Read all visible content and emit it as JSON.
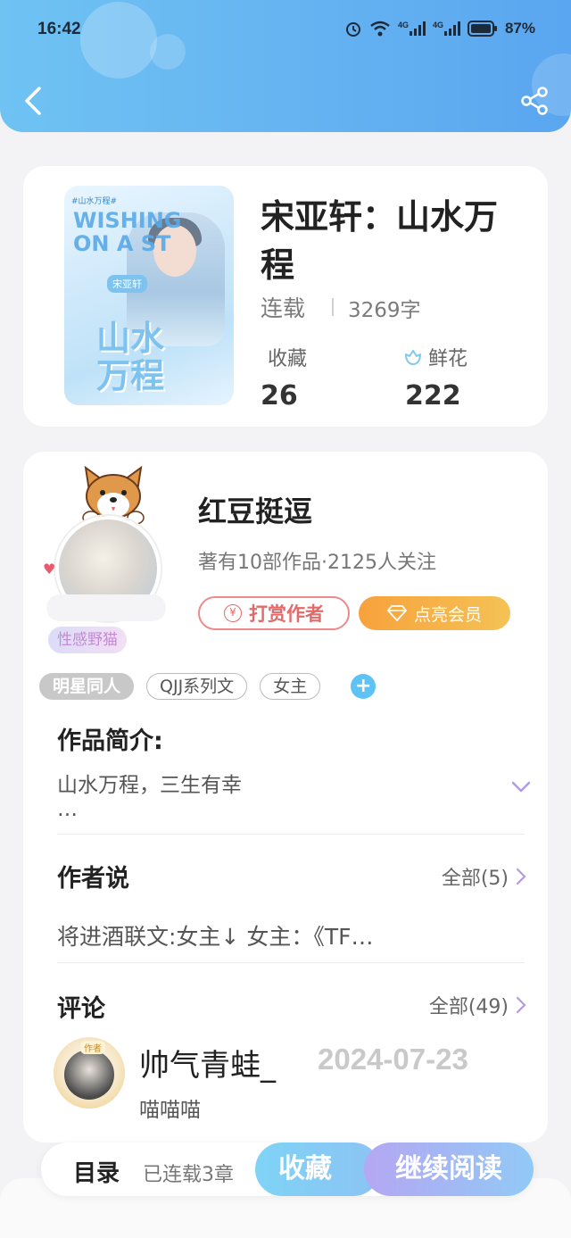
{
  "status_bar": {
    "time": "16:42",
    "network_1": "4G",
    "network_2": "4G",
    "battery": "87%"
  },
  "nav": {
    "back_icon": "chevron-left-icon",
    "share_icon": "share-icon"
  },
  "book": {
    "title": "宋亚轩：山水万程",
    "status": "连载",
    "word_count": "3269字",
    "stats": {
      "collect_label": "收藏",
      "collect_value": "26",
      "flower_label": "鲜花",
      "flower_value": "222"
    },
    "cover": {
      "header_text": "#山水万程#",
      "english_text": "WISHING ON A ST",
      "name_tag": "宋亚轩",
      "title_text": "山水万程"
    }
  },
  "author": {
    "name": "红豆挺逗",
    "meta": "著有10部作品·2125人关注",
    "badge": "性感野猫",
    "tip_button": "打赏作者",
    "tip_icon_text": "¥",
    "vip_button": "点亮会员"
  },
  "tags": [
    "明星同人",
    "QJJ系列文",
    "女主"
  ],
  "tag_add": "+",
  "intro": {
    "title": "作品简介:",
    "text": "山水万程，三生有幸",
    "ellipsis": "…"
  },
  "author_says": {
    "title": "作者说",
    "more": "全部(5)",
    "text": "将进酒联文:女主↓ 女主：《TF…"
  },
  "comments": {
    "title": "评论",
    "more": "全部(49)",
    "first": {
      "user": "帅气青蛙_",
      "date": "2024-07-23",
      "text": "喵喵喵",
      "avatar_tag": "作者"
    }
  },
  "bottom_bar": {
    "toc_label": "目录",
    "toc_count": "已连载3章",
    "collect_button": "收藏",
    "read_button": "继续阅读"
  },
  "colors": {
    "header_start": "#6fc3f3",
    "header_end": "#5aa6f0",
    "tip": "#e46a6a",
    "vip": "#f7a23c",
    "accent": "#5ec3f4"
  }
}
